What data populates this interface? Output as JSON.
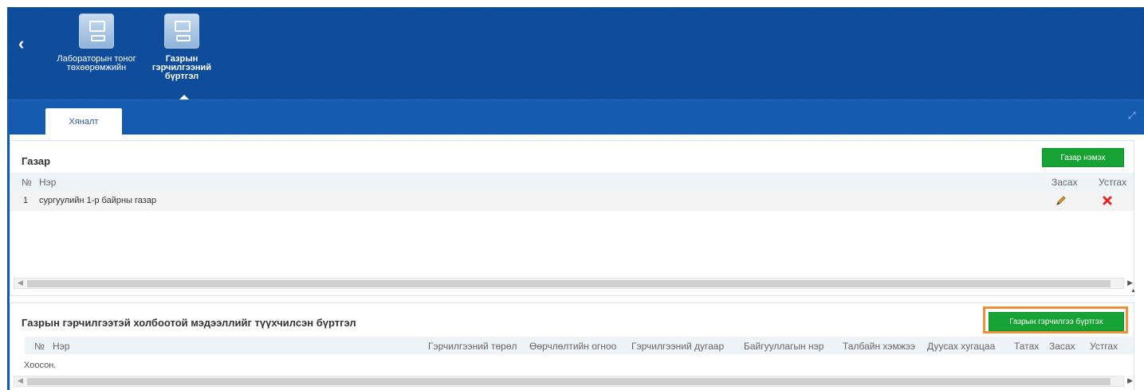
{
  "apps": [
    {
      "label": "Лабораторын тоног төхөөрөмжийн"
    },
    {
      "label": "Газрын гэрчилгээний бүртгэл"
    }
  ],
  "tabs": [
    {
      "label": "Хяналт"
    }
  ],
  "land_panel": {
    "title": "Газар",
    "add_button": "Газар нэмэх",
    "columns": {
      "no": "№",
      "name": "Нэр",
      "edit": "Засах",
      "delete": "Устгах"
    },
    "rows": [
      {
        "no": "1",
        "name": "сургуулийн 1-р байрны газар"
      }
    ]
  },
  "cert_panel": {
    "title": "Газрын гэрчилгээтэй холбоотой мэдээллийг түүхчилсэн бүртгэл",
    "register_button": "Газрын гэрчилгээ бүртгэх",
    "columns": {
      "no": "№",
      "name": "Нэр",
      "cert_type": "Гэрчилгээний төрөл",
      "ownership_date": "Өөрчлөлтийн огноо",
      "cert_number": "Гэрчилгээний дугаар",
      "org_name": "Байгууллагын нэр",
      "area_size": "Талбайн хэмжээ",
      "expiry": "Дуусах хугацаа",
      "download": "Татах",
      "edit": "Засах",
      "delete": "Устгах"
    },
    "empty_text": "Хоосон."
  },
  "colors": {
    "header_blue": "#0d4a98",
    "tab_blue": "#1359ac",
    "button_green": "#17a334",
    "highlight_orange": "#f0913a",
    "delete_red": "#e52525"
  },
  "icons": {
    "back": "chevron-left-icon",
    "expand": "expand-icon",
    "edit": "pencil-icon",
    "delete": "close-icon"
  }
}
